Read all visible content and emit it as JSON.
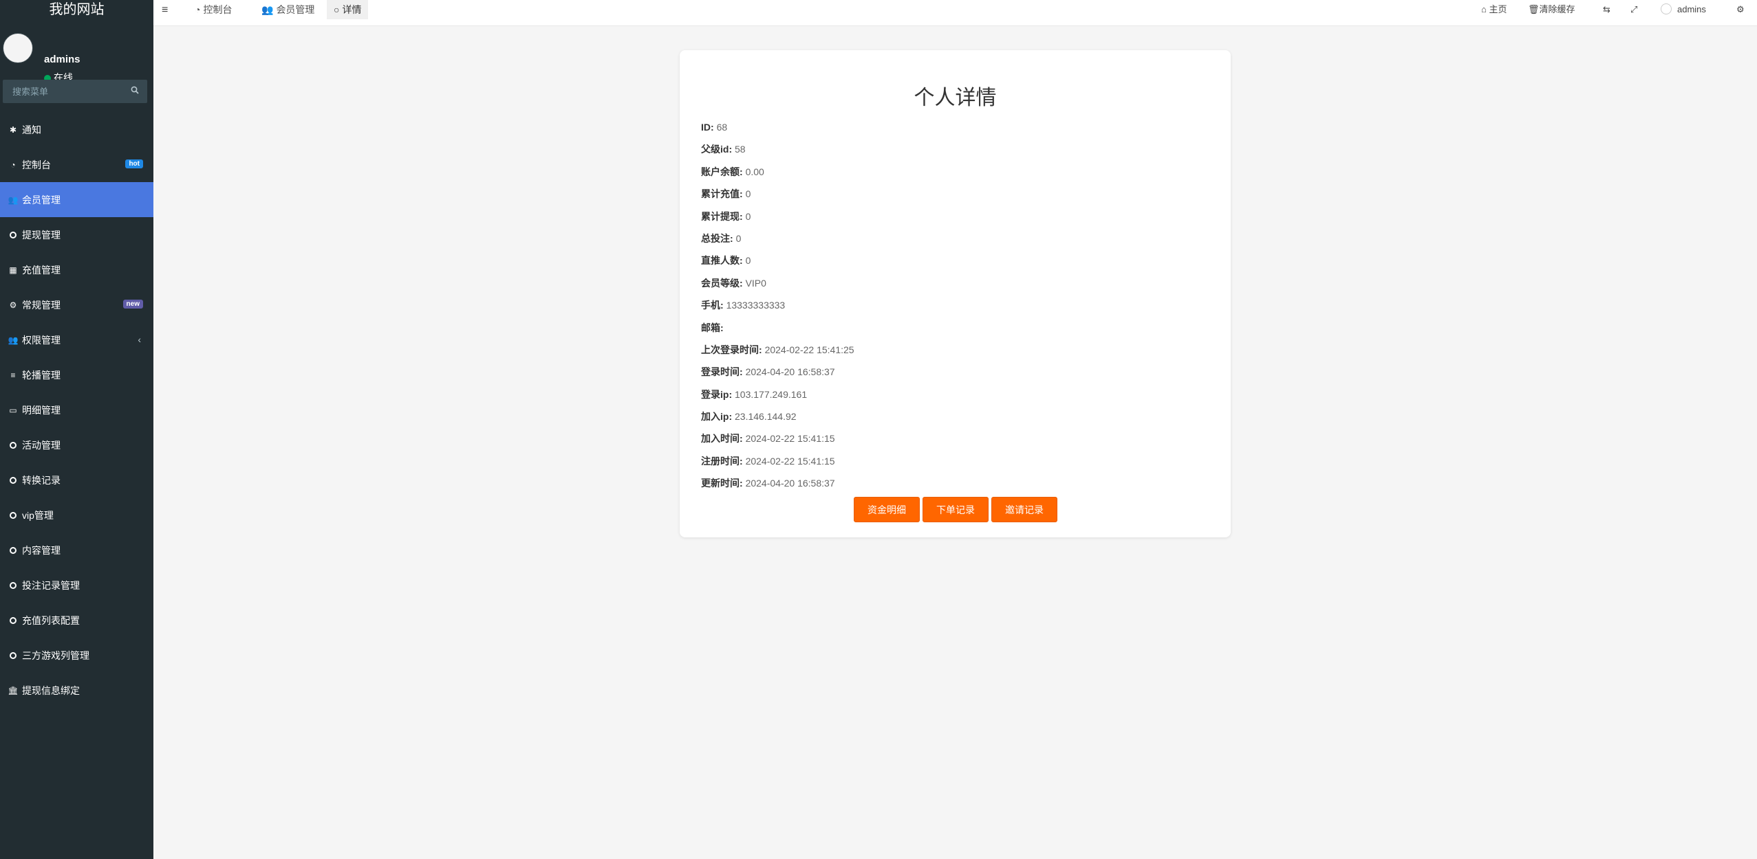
{
  "site_title": "我的网站",
  "user": {
    "name": "admins",
    "status": "在线"
  },
  "search": {
    "placeholder": "搜索菜单"
  },
  "menu": [
    {
      "label": "通知",
      "icon": "asterisk-icon"
    },
    {
      "label": "控制台",
      "icon": "dashboard-icon",
      "badge": "hot",
      "badge_color": "#1e88e5"
    },
    {
      "label": "会员管理",
      "icon": "users-icon",
      "active": true
    },
    {
      "label": "提现管理",
      "icon": "circle-icon"
    },
    {
      "label": "充值管理",
      "icon": "grid-icon"
    },
    {
      "label": "常规管理",
      "icon": "cogs-icon",
      "badge": "new",
      "badge_color": "#605ca8"
    },
    {
      "label": "权限管理",
      "icon": "users-icon",
      "caret": "‹"
    },
    {
      "label": "轮播管理",
      "icon": "list-icon"
    },
    {
      "label": "明细管理",
      "icon": "calendar-icon"
    },
    {
      "label": "活动管理",
      "icon": "circle-icon"
    },
    {
      "label": "转换记录",
      "icon": "circle-icon"
    },
    {
      "label": "vip管理",
      "icon": "circle-icon"
    },
    {
      "label": "内容管理",
      "icon": "circle-icon"
    },
    {
      "label": "投注记录管理",
      "icon": "circle-icon"
    },
    {
      "label": "充值列表配置",
      "icon": "circle-icon"
    },
    {
      "label": "三方游戏列管理",
      "icon": "circle-icon"
    },
    {
      "label": "提现信息绑定",
      "icon": "bank-icon"
    }
  ],
  "tabs": [
    {
      "label": "控制台",
      "icon": "dashboard-icon"
    },
    {
      "label": "会员管理",
      "icon": "users-icon"
    },
    {
      "label": "详情",
      "icon": "circle-icon",
      "active": true
    }
  ],
  "topbar_right": {
    "home": "主页",
    "clear_cache": "清除缓存",
    "username": "admins"
  },
  "detail": {
    "title": "个人详情",
    "fields": [
      {
        "key": "ID:",
        "value": "68"
      },
      {
        "key": "父级id:",
        "value": "58"
      },
      {
        "key": "账户余额:",
        "value": "0.00"
      },
      {
        "key": "累计充值:",
        "value": "0"
      },
      {
        "key": "累计提现:",
        "value": "0"
      },
      {
        "key": "总投注:",
        "value": "0"
      },
      {
        "key": "直推人数:",
        "value": "0"
      },
      {
        "key": "会员等级:",
        "value": "VIP0"
      },
      {
        "key": "手机:",
        "value": "13333333333"
      },
      {
        "key": "邮箱:",
        "value": ""
      },
      {
        "key": "上次登录时间:",
        "value": "2024-02-22 15:41:25"
      },
      {
        "key": "登录时间:",
        "value": "2024-04-20 16:58:37"
      },
      {
        "key": "登录ip:",
        "value": "103.177.249.161"
      },
      {
        "key": "加入ip:",
        "value": "23.146.144.92"
      },
      {
        "key": "加入时间:",
        "value": "2024-02-22 15:41:15"
      },
      {
        "key": "注册时间:",
        "value": "2024-02-22 15:41:15"
      },
      {
        "key": "更新时间:",
        "value": "2024-04-20 16:58:37"
      }
    ],
    "buttons": [
      "资金明细",
      "下单记录",
      "邀请记录"
    ],
    "button_color": "#ff6600"
  }
}
